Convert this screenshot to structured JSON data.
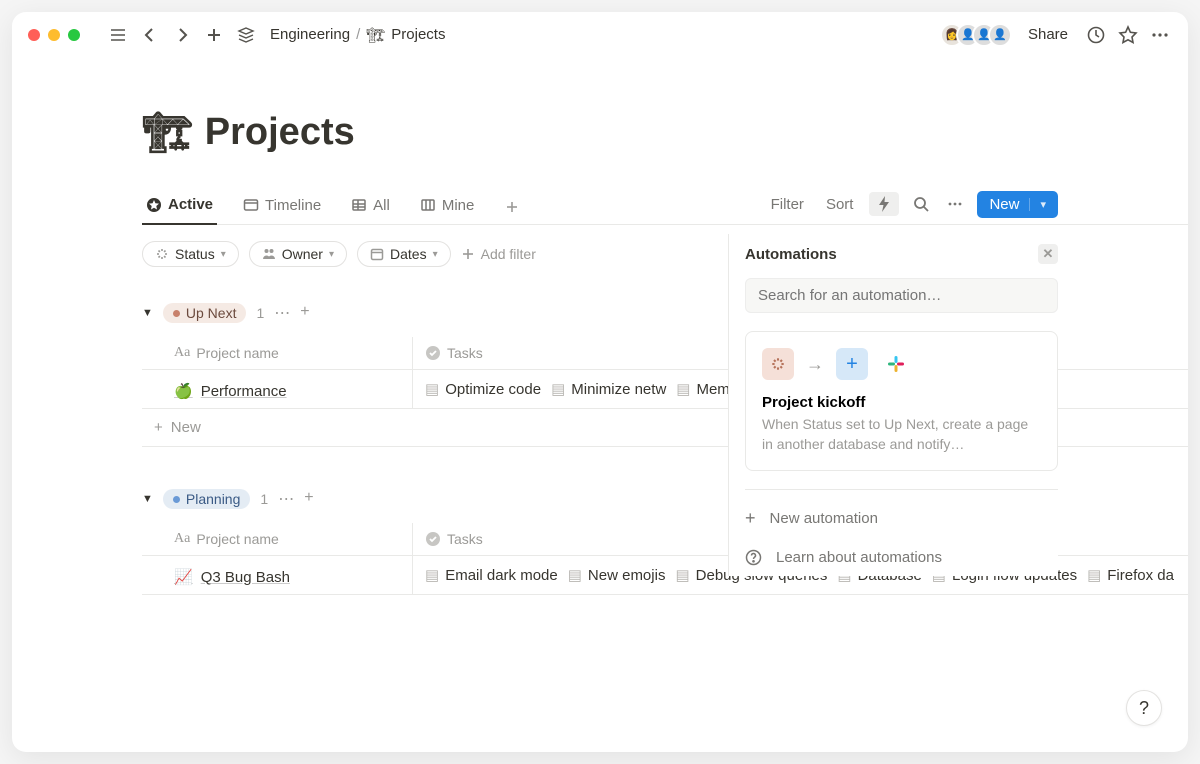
{
  "breadcrumb": {
    "parent": "Engineering",
    "current": "Projects",
    "current_icon": "🏗"
  },
  "share_label": "Share",
  "page": {
    "icon": "🏗",
    "title": "Projects"
  },
  "tabs": [
    {
      "label": "Active",
      "active": true
    },
    {
      "label": "Timeline"
    },
    {
      "label": "All"
    },
    {
      "label": "Mine"
    }
  ],
  "toolbar": {
    "filter": "Filter",
    "sort": "Sort",
    "new": "New"
  },
  "filters": {
    "status": "Status",
    "owner": "Owner",
    "dates": "Dates",
    "add": "Add filter"
  },
  "columns": {
    "name": "Project name",
    "tasks": "Tasks"
  },
  "groups": [
    {
      "tag_class": "upnext",
      "label": "Up Next",
      "count": "1",
      "rows": [
        {
          "icon": "🍏",
          "name": "Performance",
          "tasks": [
            "Optimize code",
            "Minimize netw",
            "Memory leaks"
          ]
        }
      ]
    },
    {
      "tag_class": "planning",
      "label": "Planning",
      "count": "1",
      "rows": [
        {
          "icon": "📈",
          "name": "Q3 Bug Bash",
          "tasks": [
            "Email dark mode",
            "New emojis",
            "Debug slow queries",
            "Database",
            "Login flow updates",
            "Firefox da"
          ]
        }
      ]
    }
  ],
  "new_row_label": "New",
  "automations": {
    "title": "Automations",
    "search_placeholder": "Search for an automation…",
    "card": {
      "title": "Project kickoff",
      "desc": "When Status set to Up Next, create a page in another database and notify…"
    },
    "new_automation": "New automation",
    "learn": "Learn about automations"
  },
  "help": "?"
}
